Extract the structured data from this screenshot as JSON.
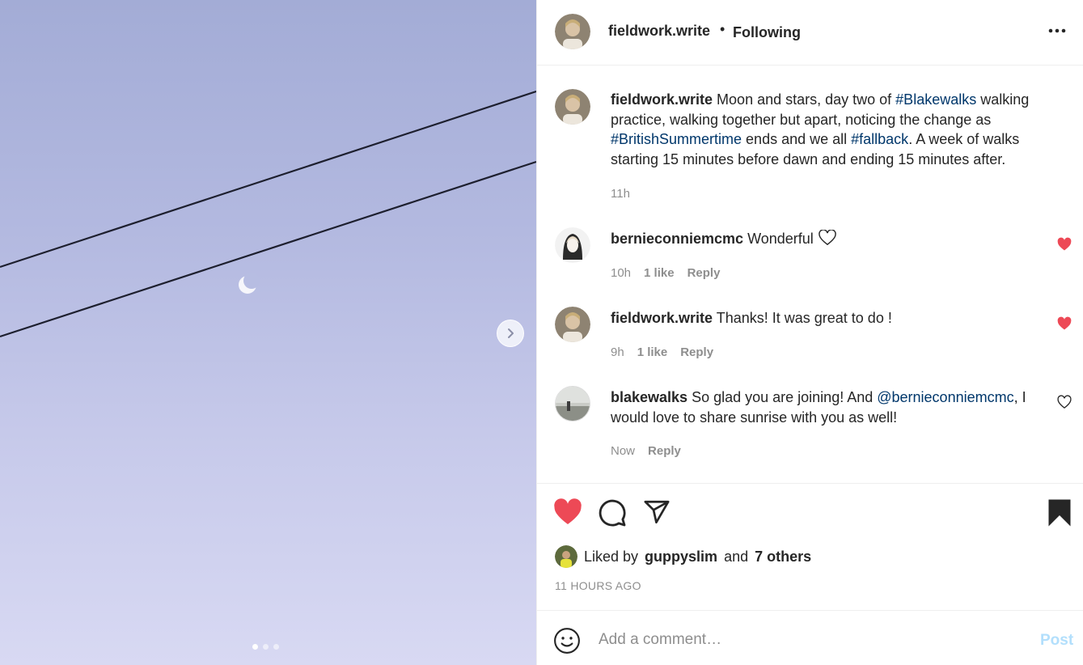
{
  "post": {
    "author": "fieldwork.write",
    "separator": "•",
    "follow_status": "Following"
  },
  "caption": {
    "user": "fieldwork.write",
    "parts": [
      "Moon and stars, day two of ",
      "#Blakewalks",
      " walking practice, walking together but apart, noticing the change as ",
      "#BritishSummertime",
      " ends and we all ",
      "#fallback",
      ". A week of walks starting 15 minutes before dawn and ending 15 minutes after."
    ],
    "time": "11h"
  },
  "comments": [
    {
      "user": "bernieconniemcmc",
      "text": "Wonderful",
      "time": "10h",
      "likes": "1 like",
      "reply": "Reply",
      "liked": true
    },
    {
      "user": "fieldwork.write",
      "text": "Thanks! It was great to do !",
      "time": "9h",
      "likes": "1 like",
      "reply": "Reply",
      "liked": true
    },
    {
      "user": "blakewalks",
      "text_before": "So glad you are joining! And ",
      "mention": "@bernieconniemcmc",
      "text_after": ", I would love to share sunrise with you as well!",
      "time": "Now",
      "reply": "Reply",
      "liked": false
    }
  ],
  "likes": {
    "prefix": "Liked by",
    "user": "guppyslim",
    "and": "and",
    "others": "7 others"
  },
  "timestamp": "11 HOURS AGO",
  "add_comment": {
    "placeholder": "Add a comment…",
    "post_label": "Post"
  },
  "carousel": {
    "slides": 3,
    "active": 1
  },
  "colors": {
    "like_red": "#ed4956",
    "link_blue": "#00376b",
    "post_disabled": "#b2dffc",
    "muted": "#8e8e8e"
  },
  "icons": [
    "chevron-right-icon",
    "more-options-icon",
    "heart-icon",
    "comment-icon",
    "share-icon",
    "bookmark-icon",
    "emoji-icon"
  ]
}
